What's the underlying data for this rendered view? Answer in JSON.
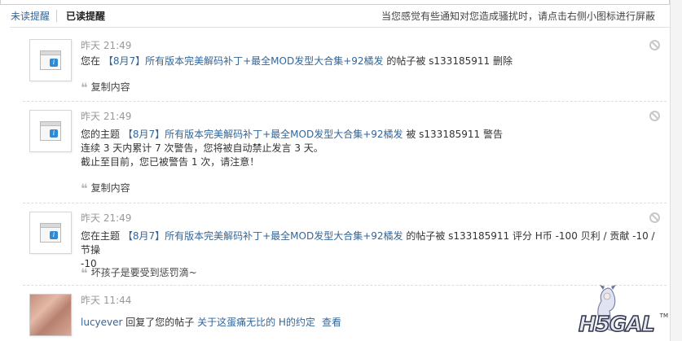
{
  "tabs": {
    "unread": "未读提醒",
    "read": "已读提醒",
    "hint": "当您感觉有些通知对您造成骚扰时，请点击右侧小图标进行屏蔽"
  },
  "notices": [
    {
      "time": "昨天 21:49",
      "line1_pre": "您在 ",
      "thread": "【8月7】所有版本完美解码补丁+最全MOD发型大合集+92橘发",
      "line1_post": " 的帖子被 s133185911 删除",
      "quote": "复制内容"
    },
    {
      "time": "昨天 21:49",
      "line1_pre": "您的主题 ",
      "thread": "【8月7】所有版本完美解码补丁+最全MOD发型大合集+92橘发",
      "line1_post": " 被 s133185911 警告",
      "line2": "连续 3 天内累计 7 次警告，您将被自动禁止发言 3 天。",
      "line3": "截止至目前，您已被警告 1 次，请注意！",
      "quote": "复制内容"
    },
    {
      "time": "昨天 21:49",
      "line1_pre": "您在主题 ",
      "thread": "【8月7】所有版本完美解码补丁+最全MOD发型大合集+92橘发",
      "line1_post": " 的帖子被 s133185911 评分 H币 -100 贝利 / 贡献 -10 / 节操",
      "line2": "-10",
      "quote": "坏孩子是要受到惩罚滴~"
    },
    {
      "time": "昨天 11:44",
      "user": "lucyever",
      "action": " 回复了您的帖子 ",
      "thread": "关于这蛋痛无比的 H的约定",
      "view": "查看"
    }
  ],
  "logo": {
    "text": "H5GAL",
    "tm": "TM"
  }
}
